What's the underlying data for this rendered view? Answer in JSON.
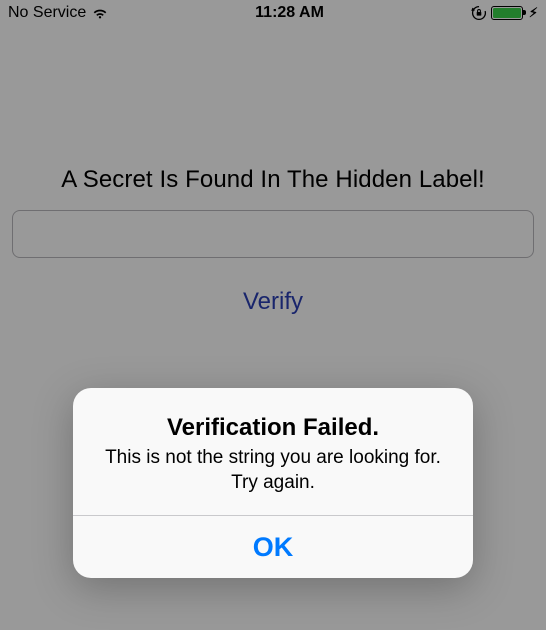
{
  "status_bar": {
    "carrier": "No Service",
    "time": "11:28 AM"
  },
  "main": {
    "title": "A Secret Is Found In The Hidden Label!",
    "input_value": "",
    "verify_label": "Verify"
  },
  "alert": {
    "title": "Verification Failed.",
    "message": "This is not the string you are looking for. Try again.",
    "ok_label": "OK"
  },
  "colors": {
    "link": "#2b3fb5",
    "alert_button": "#007aff",
    "battery_fill": "#39d24a"
  }
}
